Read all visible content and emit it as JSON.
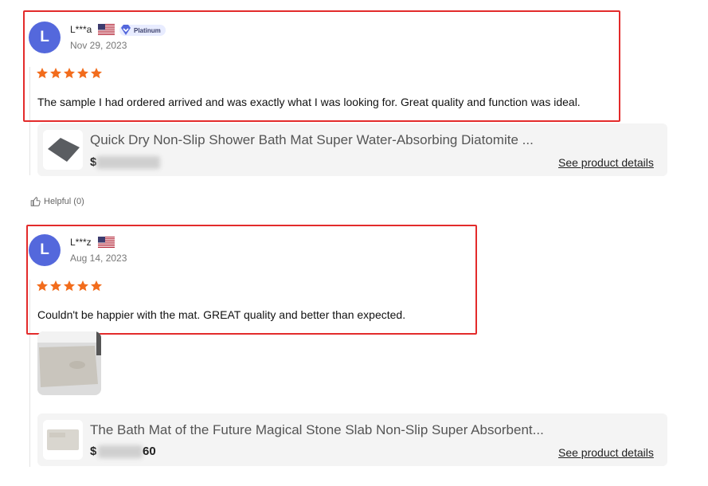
{
  "colors": {
    "accent_star": "#f26c1c",
    "avatar_bg": "#5468dc",
    "highlight_border": "#e32b2b"
  },
  "reviews": [
    {
      "avatar_letter": "L",
      "name": "L***a",
      "flag": "us-flag-icon",
      "badge": "Platinum",
      "date": "Nov 29, 2023",
      "rating": 5,
      "text": "The sample I had ordered arrived and was exactly what I was looking for. Great quality and function was ideal.",
      "product": {
        "title": "Quick Dry Non-Slip Shower Bath Mat Super Water-Absorbing Diatomite ...",
        "price_visible": "$",
        "details_link": "See product details"
      },
      "helpful": "Helpful (0)"
    },
    {
      "avatar_letter": "L",
      "name": "L***z",
      "flag": "us-flag-icon",
      "date": "Aug 14, 2023",
      "rating": 5,
      "text": "Couldn't be happier with the mat. GREAT quality and better than expected.",
      "product": {
        "title": "The Bath Mat of the Future Magical Stone Slab Non-Slip Super Absorbent...",
        "price_visible": "$",
        "price_tail": "60",
        "details_link": "See product details"
      }
    }
  ]
}
